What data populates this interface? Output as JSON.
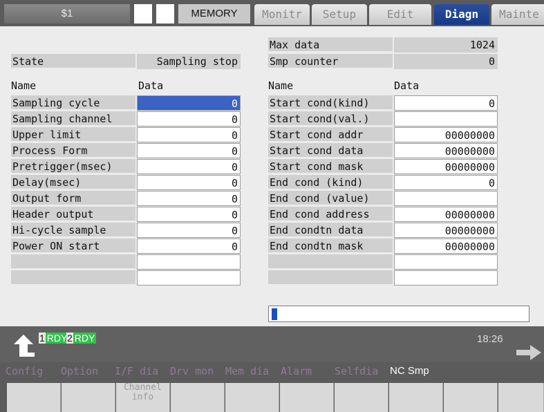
{
  "header": {
    "system": "$1",
    "mode": "MEMORY",
    "tabs": [
      "Monitr",
      "Setup",
      "Edit",
      "Diagn",
      "Mainte"
    ],
    "active_tab": "Diagn"
  },
  "left": {
    "state_label": "State",
    "state_value": "Sampling stop",
    "name_header": "Name",
    "data_header": "Data",
    "rows": [
      {
        "name": "Sampling cycle",
        "value": "0"
      },
      {
        "name": "Sampling channel",
        "value": "0"
      },
      {
        "name": "Upper limit",
        "value": "0"
      },
      {
        "name": "Process Form",
        "value": "0"
      },
      {
        "name": "Pretrigger(msec)",
        "value": "0"
      },
      {
        "name": "Delay(msec)",
        "value": "0"
      },
      {
        "name": "Output form",
        "value": "0"
      },
      {
        "name": "Header output",
        "value": "0"
      },
      {
        "name": "Hi-cycle sample",
        "value": "0"
      },
      {
        "name": "Power ON start",
        "value": "0"
      },
      {
        "name": "",
        "value": ""
      },
      {
        "name": "",
        "value": ""
      }
    ]
  },
  "right": {
    "max_label": "Max data",
    "max_value": "1024",
    "counter_label": "Smp counter",
    "counter_value": "0",
    "name_header": "Name",
    "data_header": "Data",
    "rows": [
      {
        "name": "Start cond(kind)",
        "value": "0"
      },
      {
        "name": "Start cond(val.)",
        "value": ""
      },
      {
        "name": "Start cond addr",
        "value": "00000000"
      },
      {
        "name": "Start cond data",
        "value": "00000000"
      },
      {
        "name": "Start cond mask",
        "value": "00000000"
      },
      {
        "name": "End cond (kind)",
        "value": "0"
      },
      {
        "name": "End cond (value)",
        "value": ""
      },
      {
        "name": "End cond address",
        "value": "00000000"
      },
      {
        "name": "End condtn data",
        "value": "00000000"
      },
      {
        "name": "End condtn mask",
        "value": "00000000"
      },
      {
        "name": "",
        "value": ""
      },
      {
        "name": "",
        "value": ""
      }
    ]
  },
  "progress": {
    "fraction": 0.02
  },
  "status": {
    "ch1_num": "1",
    "ch1_tag": "RDY",
    "ch2_num": "2",
    "ch2_tag": "RDY",
    "time": "18:26"
  },
  "menu": [
    "Config",
    "Option",
    "I/F dia",
    "Drv mon",
    "Mem dia",
    "Alarm",
    "Selfdia",
    "NC Smp"
  ],
  "softkeys": [
    "",
    "",
    "Channel info",
    "",
    "",
    "",
    "",
    "",
    "",
    ""
  ],
  "colors": {
    "accent": "#1a4fc2",
    "ready": "#31c24a",
    "active_tab": "#173a85"
  }
}
